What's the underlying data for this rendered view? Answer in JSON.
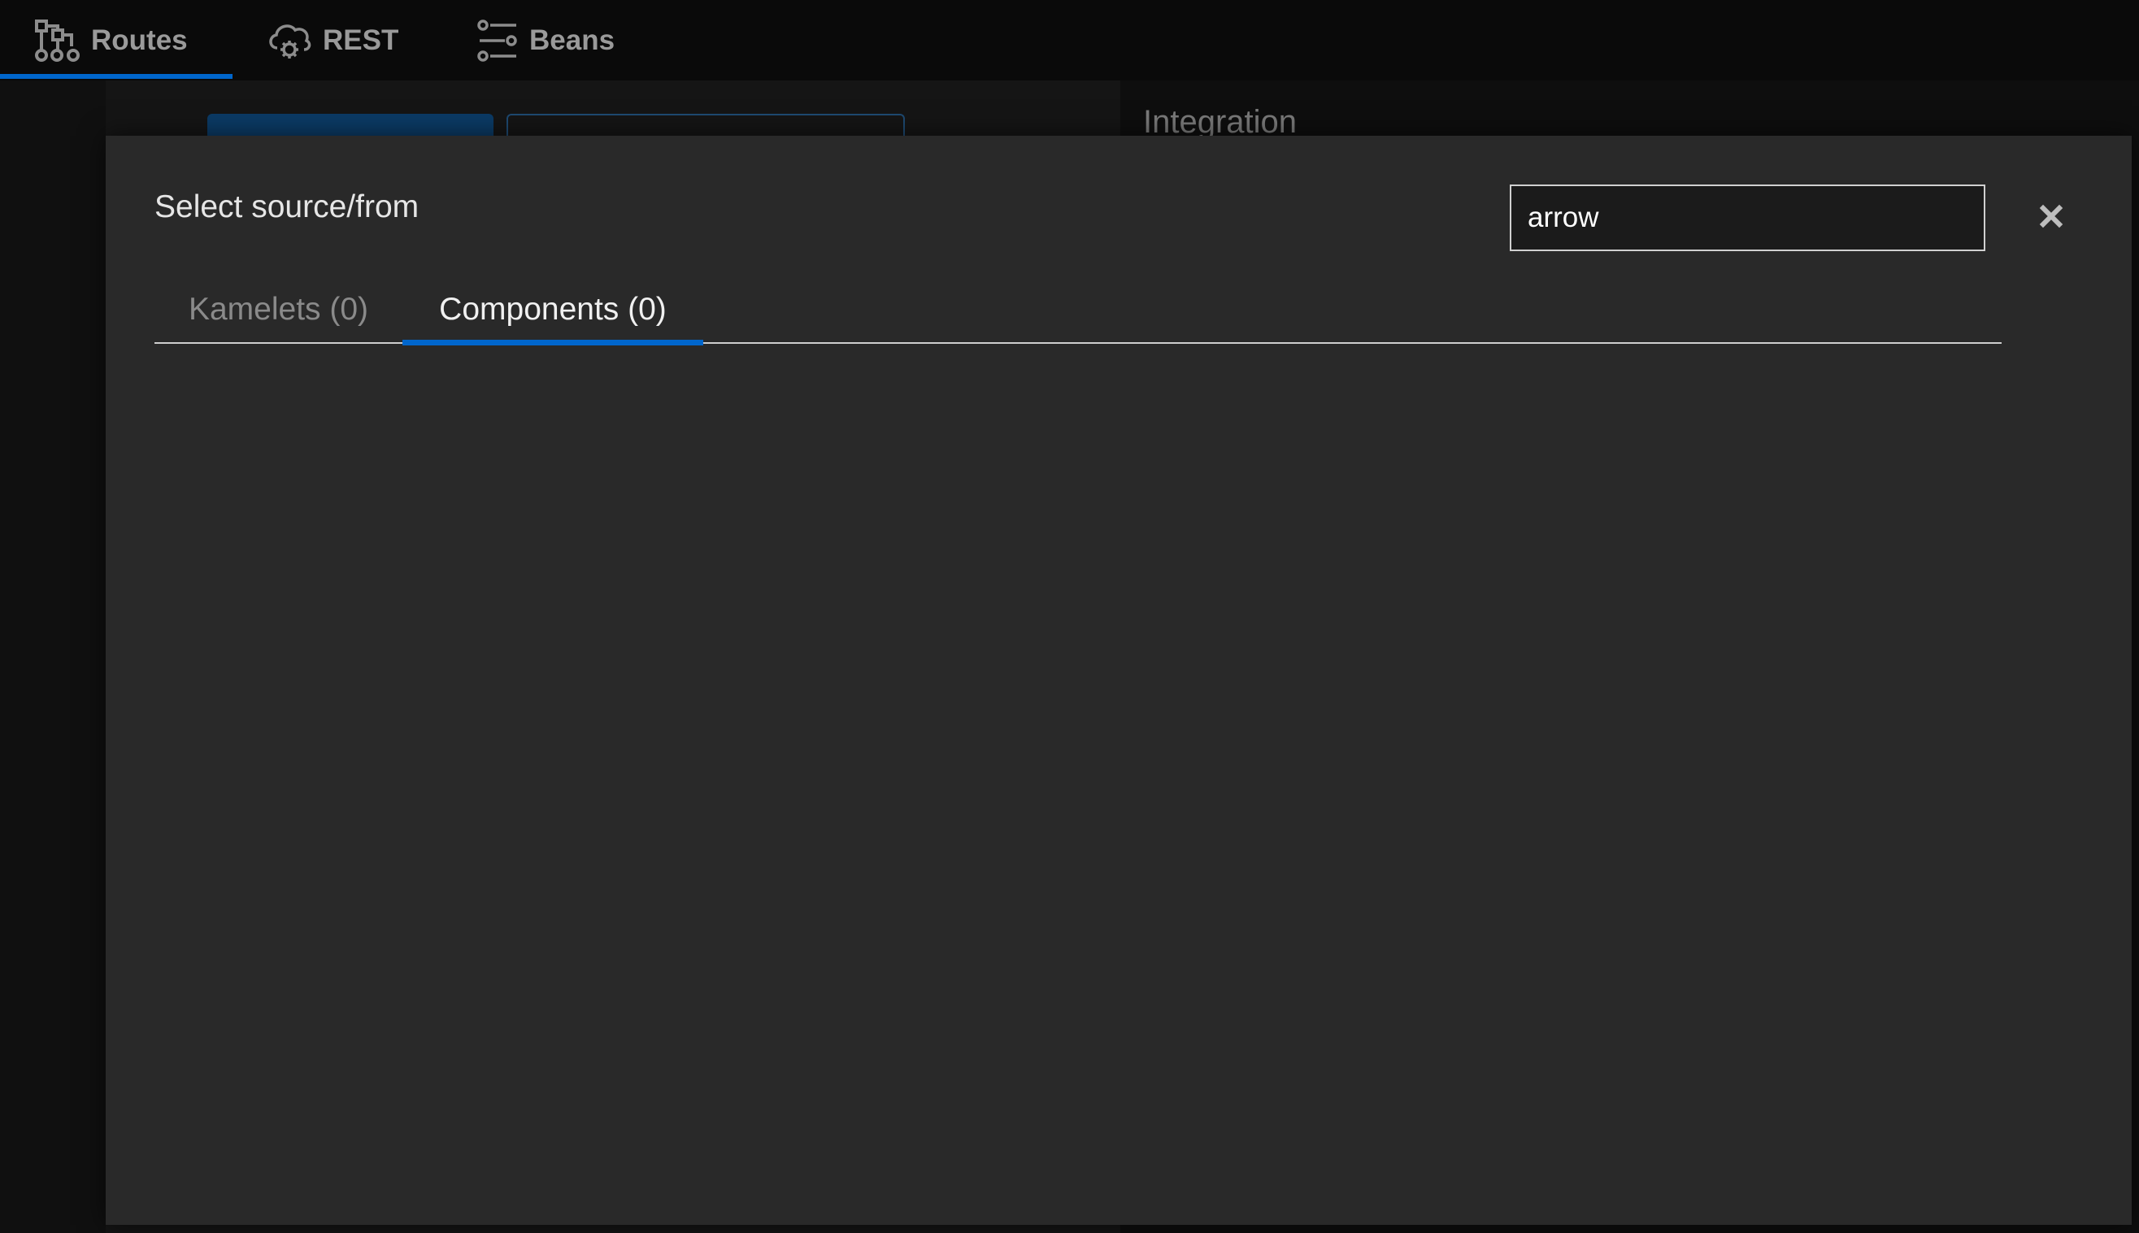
{
  "topbar": {
    "tabs": [
      {
        "label": "Routes",
        "icon": "routes-topology-icon",
        "active": true
      },
      {
        "label": "REST",
        "icon": "cloud-gear-icon",
        "active": false
      },
      {
        "label": "Beans",
        "icon": "sliders-icon",
        "active": false
      }
    ]
  },
  "background": {
    "integration_label": "Integration"
  },
  "modal": {
    "title": "Select source/from",
    "search": {
      "value": "arrow",
      "placeholder": ""
    },
    "tabs": [
      {
        "label": "Kamelets (0)",
        "active": false
      },
      {
        "label": "Components (0)",
        "active": true
      }
    ],
    "close_icon": "close-icon"
  },
  "colors": {
    "accent": "#0066cc",
    "modal_bg": "#292929",
    "topbar_bg": "#0a0a0a"
  }
}
